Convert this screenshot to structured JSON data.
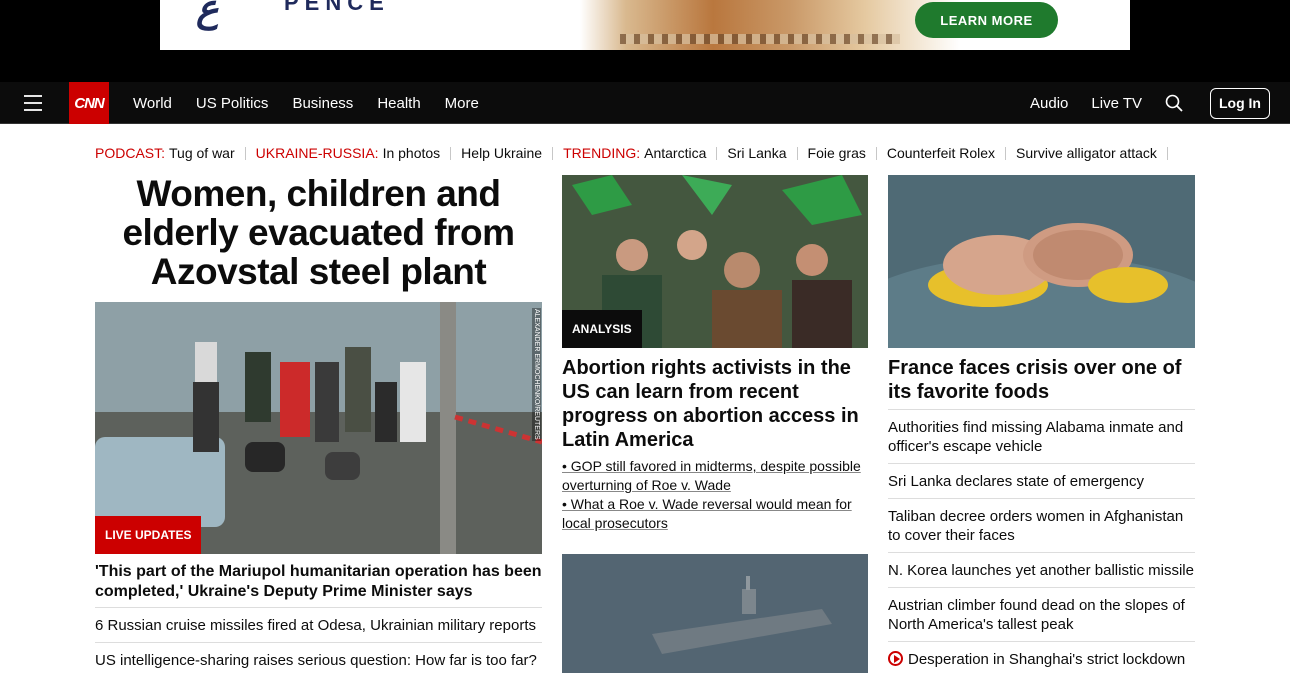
{
  "ad": {
    "cta_label": "LEARN MORE",
    "logo_text": "PENCE"
  },
  "nav": {
    "logo": "CNN",
    "links": [
      "World",
      "US Politics",
      "Business",
      "Health",
      "More"
    ],
    "right_links": [
      "Audio",
      "Live TV"
    ],
    "login_label": "Log In"
  },
  "trending": [
    {
      "label": "PODCAST:",
      "text": "Tug of war"
    },
    {
      "label": "UKRAINE-RUSSIA:",
      "text": "In photos"
    },
    {
      "label": "",
      "text": "Help Ukraine"
    },
    {
      "label": "TRENDING:",
      "text": "Antarctica"
    },
    {
      "label": "",
      "text": "Sri Lanka"
    },
    {
      "label": "",
      "text": "Foie gras"
    },
    {
      "label": "",
      "text": "Counterfeit Rolex"
    },
    {
      "label": "",
      "text": "Survive alligator attack"
    }
  ],
  "left": {
    "headline": "Women, children and elderly evacuated from Azovstal steel plant",
    "image_credit": "ALEXANDER ERMOCHENKO/REUTERS",
    "badge": "LIVE UPDATES",
    "sub_headline": "'This part of the Mariupol humanitarian operation has been completed,' Ukraine's Deputy Prime Minister says",
    "list": [
      "6 Russian cruise missiles fired at Odesa, Ukrainian military reports",
      "US intelligence-sharing raises serious question: How far is too far?"
    ]
  },
  "middle": {
    "badge": "ANALYSIS",
    "headline": "Abortion rights activists in the US can learn from recent progress on abortion access in Latin America",
    "bullets": [
      "• GOP still favored in midterms, despite possible overturning of Roe v. Wade",
      "• What a Roe v. Wade reversal would mean for local prosecutors"
    ]
  },
  "right": {
    "headline": "France faces crisis over one of its favorite foods",
    "list": [
      "Authorities find missing Alabama inmate and officer's escape vehicle",
      "Sri Lanka declares state of emergency",
      "Taliban decree orders women in Afghanistan to cover their faces",
      "N. Korea launches yet another ballistic missile",
      "Austrian climber found dead on the slopes of North America's tallest peak",
      "Desperation in Shanghai's strict lockdown"
    ]
  },
  "colors": {
    "brand_red": "#cc0000",
    "nav_bg": "#0c0c0c",
    "ad_cta": "#1f7a2d"
  }
}
